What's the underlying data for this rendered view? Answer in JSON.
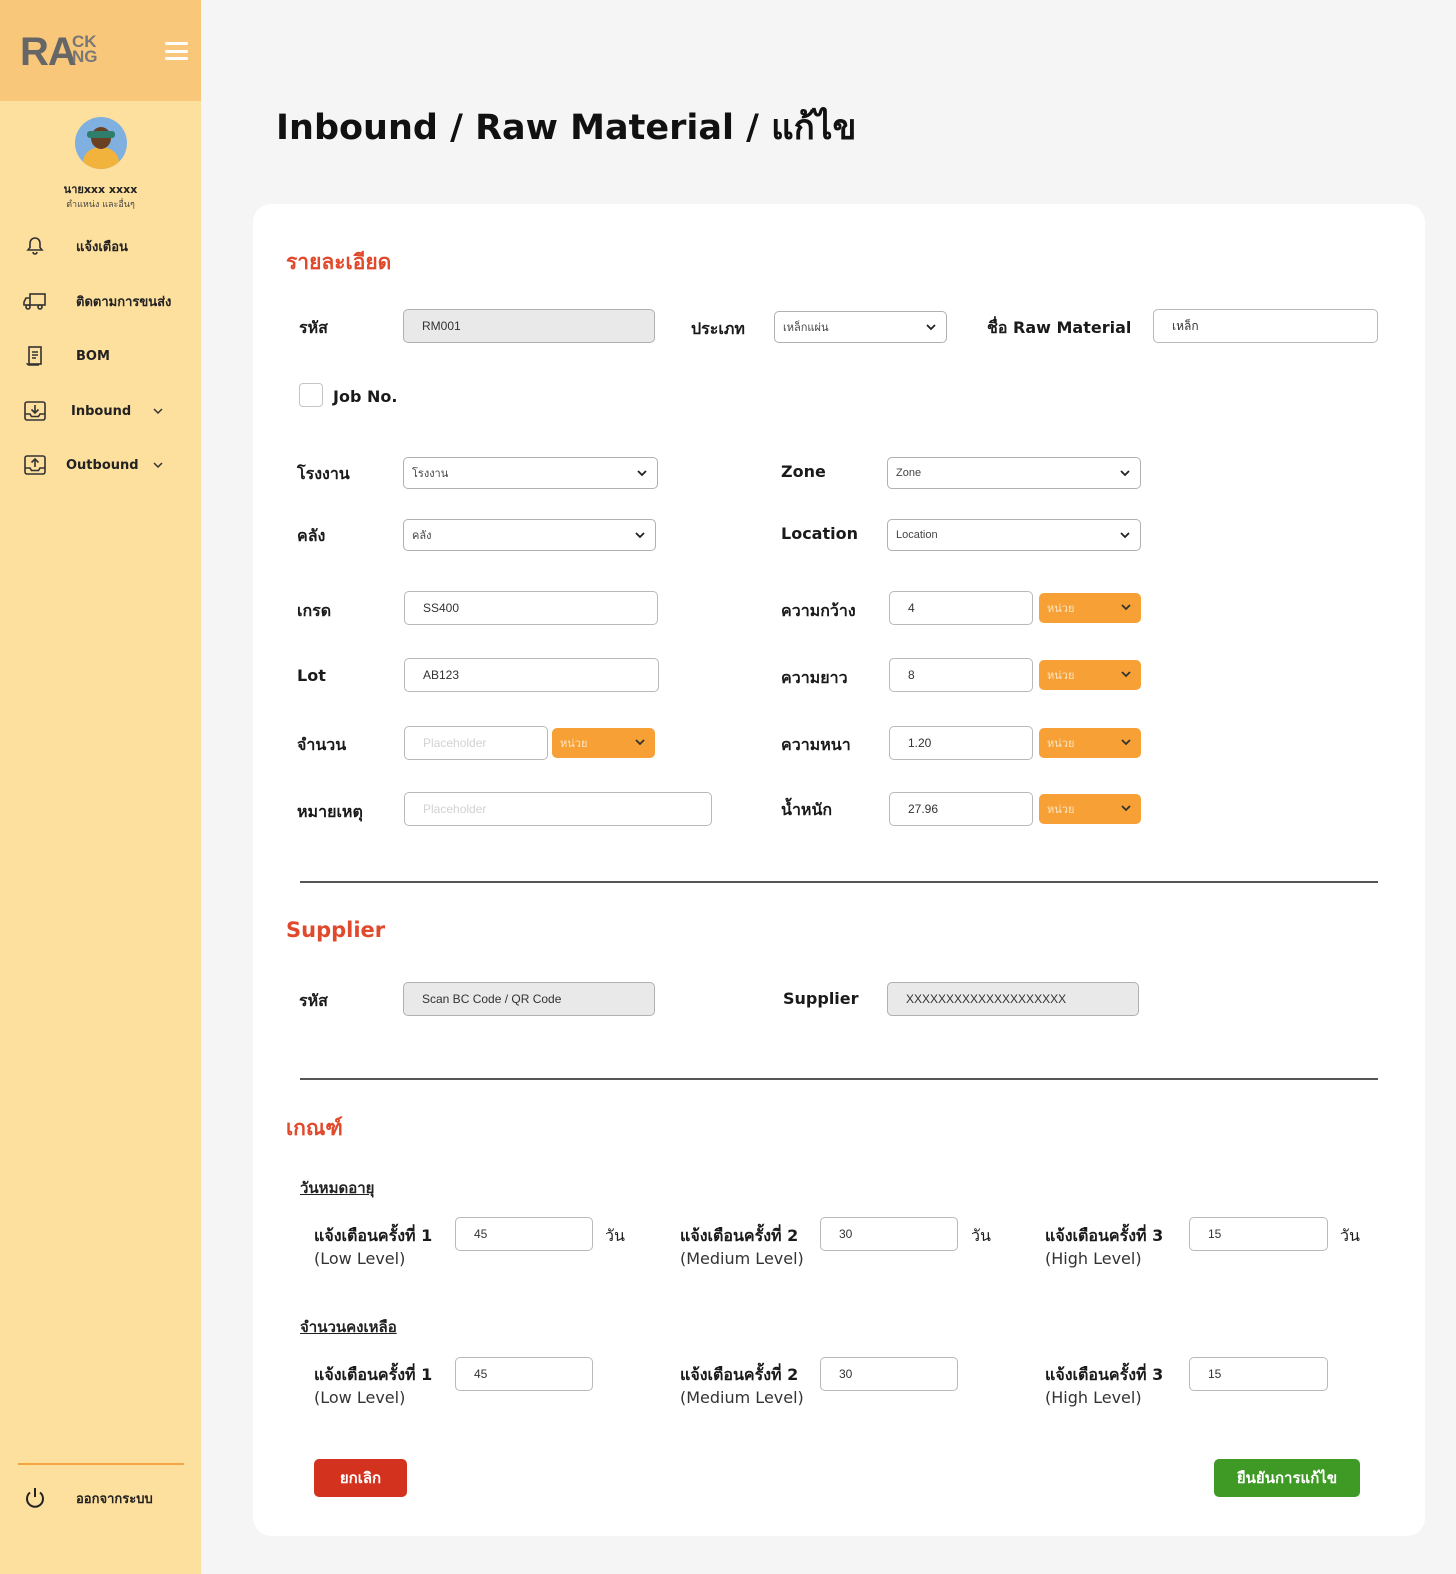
{
  "brand": {
    "logo_main": "RA",
    "logo_top": "CK",
    "logo_bottom": "NG"
  },
  "user": {
    "name": "นายxxx xxxx",
    "role": "ตำแหน่ง และอื่นๆ"
  },
  "nav": {
    "notifications": "แจ้งเตือน",
    "tracking": "ติดตามการขนส่ง",
    "bom": "BOM",
    "inbound": "Inbound",
    "outbound": "Outbound",
    "logout": "ออกจากระบบ"
  },
  "page": {
    "title": "Inbound / Raw Material / แก้ไข"
  },
  "details": {
    "section_title": "รายละเอียด",
    "code_label": "รหัส",
    "code_value": "RM001",
    "type_label": "ประเภท",
    "type_value": "เหล็กแผ่น",
    "name_label": "ชื่อ Raw Material",
    "name_value": "เหล็ก",
    "job_label": "Job No.",
    "factory_label": "โรงงาน",
    "factory_value": "โรงงาน",
    "zone_label": "Zone",
    "zone_value": "Zone",
    "warehouse_label": "คลัง",
    "warehouse_value": "คลัง",
    "location_label": "Location",
    "location_value": "Location",
    "grade_label": "เกรด",
    "grade_value": "SS400",
    "width_label": "ความกว้าง",
    "width_value": "4",
    "lot_label": "Lot",
    "lot_value": "AB123",
    "length_label": "ความยาว",
    "length_value": "8",
    "qty_label": "จำนวน",
    "qty_placeholder": "Placeholder",
    "thickness_label": "ความหนา",
    "thickness_value": "1.20",
    "note_label": "หมายเหตุ",
    "note_placeholder": "Placeholder",
    "weight_label": "น้ำหนัก",
    "weight_value": "27.96",
    "unit_label": "หน่วย"
  },
  "supplier": {
    "section_title": "Supplier",
    "code_label": "รหัส",
    "code_value": "Scan BC Code / QR Code",
    "name_label": "Supplier",
    "name_value": "XXXXXXXXXXXXXXXXXXXX"
  },
  "criteria": {
    "section_title": "เกณฑ์",
    "expiry_title": "วันหมดอายุ",
    "remaining_title": "จำนวนคงเหลือ",
    "alert1": "แจ้งเตือนครั้งที่ 1",
    "alert1_level": "(Low Level)",
    "alert2": "แจ้งเตือนครั้งที่ 2",
    "alert2_level": "(Medium Level)",
    "alert3": "แจ้งเตือนครั้งที่ 3",
    "alert3_level": "(High Level)",
    "day_unit": "วัน",
    "expiry_values": [
      "45",
      "30",
      "15"
    ],
    "remaining_values": [
      "45",
      "30",
      "15"
    ]
  },
  "actions": {
    "cancel": "ยกเลิก",
    "confirm": "ยืนยันการแก้ไข"
  },
  "colors": {
    "accent": "#e0492b",
    "sidebar": "#fddf9e",
    "brand_bar": "#f9c77a",
    "unit_select": "#f7a035",
    "cancel": "#d3321f",
    "confirm": "#3f9a25"
  }
}
